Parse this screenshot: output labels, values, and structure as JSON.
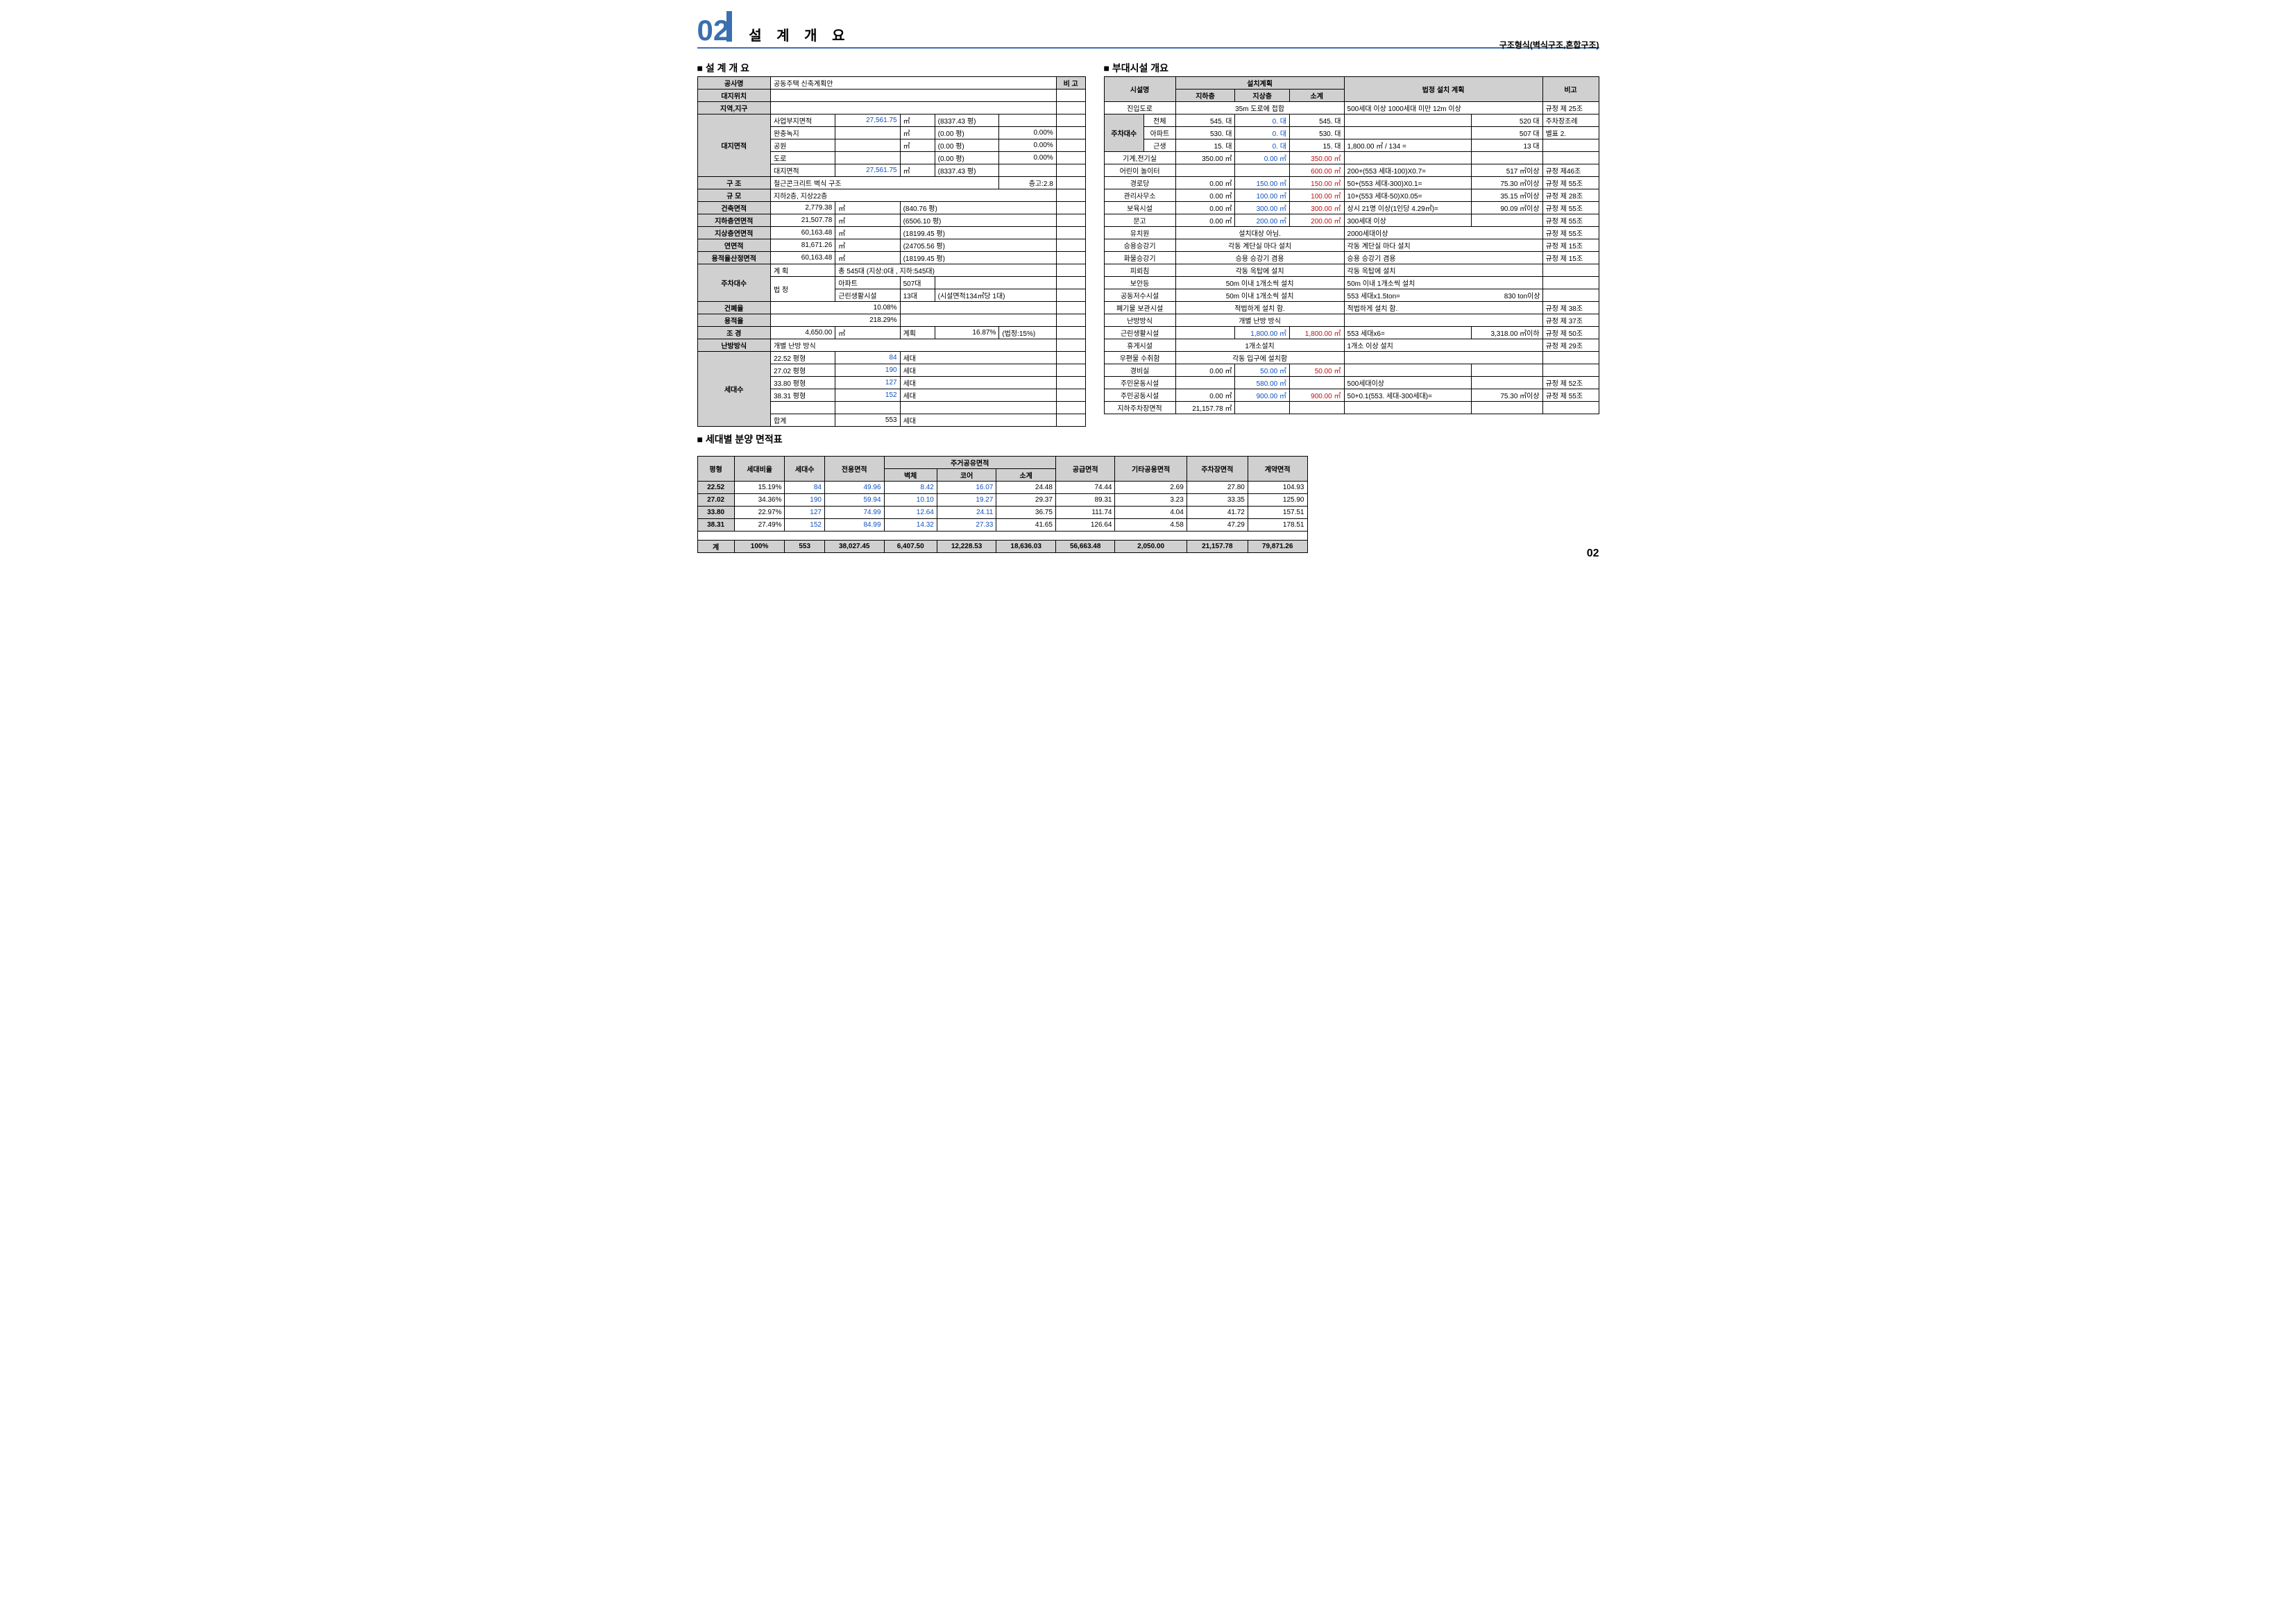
{
  "header": {
    "num": "02",
    "title": "설 계 개 요",
    "sub": "구조형식(벽식구조,혼합구조)",
    "pageNum": "02"
  },
  "sec": {
    "t1": "설 계 개 요",
    "t2": "부대시설 개요",
    "t3": "세대별 분양 면적표"
  },
  "t1": {
    "h": {
      "bigo": "비 고",
      "gongsa": "공사명",
      "gongsa_v": "공동주택 신축계획안",
      "daeji": "대지위치",
      "jiyeok": "지역,지구"
    },
    "dm": {
      "label": "대지면적",
      "r1": {
        "a": "사업부지면적",
        "b": "27,561.75",
        "c": "㎡",
        "d": "(8337.43 평)",
        "e": ""
      },
      "r2": {
        "a": "완충녹지",
        "b": "",
        "c": "㎡",
        "d": "(0.00 평)",
        "e": "0.00%"
      },
      "r3": {
        "a": "공원",
        "b": "",
        "c": "㎡",
        "d": "(0.00 평)",
        "e": "0.00%"
      },
      "r4": {
        "a": "도로",
        "b": "",
        "c": "",
        "d": "(0.00 평)",
        "e": "0.00%"
      },
      "r5": {
        "a": "대지면적",
        "b": "27,561.75",
        "c": "㎡",
        "d": "(8337.43 평)",
        "e": ""
      }
    },
    "gu": {
      "a": "구   조",
      "b": "철근콘크리트 벽식 구조",
      "c": "층고:2.8"
    },
    "gyu": {
      "a": "규   모",
      "b": "지하2층, 지상22층"
    },
    "gm": {
      "a": "건축면적",
      "b": "2,779.38",
      "c": "㎡",
      "d": "(840.76 평)"
    },
    "jh": {
      "a": "지하층연면적",
      "b": "21,507.78",
      "c": "㎡",
      "d": "(6506.10 평)"
    },
    "js": {
      "a": "지상층연면적",
      "b": "60,163.48",
      "c": "㎡",
      "d": "(18199.45 평)"
    },
    "ym": {
      "a": "연면적",
      "b": "81,671.26",
      "c": "㎡",
      "d": "(24705.56 평)"
    },
    "yr": {
      "a": "용적율산정면적",
      "b": "60,163.48",
      "c": "㎡",
      "d": "(18199.45 평)"
    },
    "ju": {
      "label": "주차대수",
      "r1": {
        "a": "계 획",
        "b": "총  545대 (지상:0대 , 지하:545대)"
      },
      "r2": {
        "a": "법  정",
        "b": "아파트",
        "c": "507대"
      },
      "r3": {
        "b": "근린생활시설",
        "c": "13대",
        "d": "(시설면적134㎡당 1대)"
      }
    },
    "gp": {
      "a": "건폐율",
      "b": "10.08%"
    },
    "yj": {
      "a": "용적율",
      "b": "218.29%"
    },
    "jo": {
      "a": "조   경",
      "b": "4,650.00",
      "c": "㎡",
      "d": "계획",
      "e": "16.87%",
      "f": "(법정:15%)"
    },
    "nb": {
      "a": "난방방식",
      "b": "개별 난방 방식"
    },
    "sd": {
      "label": "세대수",
      "r1": {
        "a": "22.52 평형",
        "b": "84",
        "c": "세대"
      },
      "r2": {
        "a": "27.02 평형",
        "b": "190",
        "c": "세대"
      },
      "r3": {
        "a": "33.80 평형",
        "b": "127",
        "c": "세대"
      },
      "r4": {
        "a": "38.31 평형",
        "b": "152",
        "c": "세대"
      },
      "r6": {
        "a": "합계",
        "b": "553",
        "c": "세대"
      }
    }
  },
  "t2": {
    "h": {
      "sisul": "시설명",
      "plan": "설치계획",
      "jh": "지하층",
      "js": "지상층",
      "so": "소계",
      "law": "법정 설치 계획",
      "bigo": "비고"
    },
    "rows": [
      {
        "a": "진입도로",
        "m": "35m 도로에 접합",
        "law": "500세대 이상 1000세대 미만 12m 이상",
        "bg": "규정 제 25조"
      },
      {
        "a": "주차대수",
        "sp": "3",
        "sub": [
          {
            "b": "전체",
            "c": "545. 대",
            "d": "0. 대",
            "e": "545. 대",
            "law": "",
            "lv": "520 대",
            "bg": "주차장조례"
          },
          {
            "b": "아파트",
            "c": "530. 대",
            "d": "0. 대",
            "e": "530. 대",
            "law": "",
            "lv": "507 대",
            "bg": "별표 2."
          },
          {
            "b": "근생",
            "c": "15. 대",
            "d": "0. 대",
            "e": "15. 대",
            "law": "1,800.00 ㎡ / 134   =",
            "lv": "13 대",
            "bg": ""
          }
        ]
      },
      {
        "a": "기계,전기실",
        "c": "350.00 ㎡",
        "d": "0.00 ㎡",
        "e": "350.00 ㎡",
        "law": "",
        "bg": ""
      },
      {
        "a": "어린이 놀이터",
        "c": "",
        "d": "",
        "e": "600.00 ㎡",
        "law": "200+(553 세대-100)X0.7=",
        "lv": "517 ㎡이상",
        "bg": "규정 제46조"
      },
      {
        "a": "경로당",
        "c": "0.00 ㎡",
        "d": "150.00 ㎡",
        "e": "150.00 ㎡",
        "law": "50+(553 세대-300)X0.1=",
        "lv": "75.30 ㎡이상",
        "bg": "규정 제 55조"
      },
      {
        "a": "관리사무소",
        "c": "0.00 ㎡",
        "d": "100.00 ㎡",
        "e": "100.00 ㎡",
        "law": "10+(553 세대-50)X0.05=",
        "lv": "35.15 ㎡이상",
        "bg": "규정 제 28조"
      },
      {
        "a": "보육시설",
        "c": "0.00 ㎡",
        "d": "300.00 ㎡",
        "e": "300.00 ㎡",
        "law": "상시 21명 이상(1인당 4.29㎡)=",
        "lv": "90.09 ㎡이상",
        "bg": "규정 제 55조"
      },
      {
        "a": "문고",
        "c": "0.00 ㎡",
        "d": "200.00 ㎡",
        "e": "200.00 ㎡",
        "law": "300세대 이상",
        "lv": "",
        "bg": "규정 제 55조"
      },
      {
        "a": "유치원",
        "m": "설치대상 아님.",
        "law": "2000세대이상",
        "bg": "규정 제 55조"
      },
      {
        "a": "승용승강기",
        "m": "각동 계단실 마다 설치",
        "law": "각동 계단실 마다 설치",
        "bg": "규정 제 15조"
      },
      {
        "a": "화물승강기",
        "m": "승용 승강기 겸용",
        "law": "승용 승강기 겸용",
        "bg": "규정 제 15조"
      },
      {
        "a": "피뢰침",
        "m": "각동 옥탑에 설치",
        "law": "각동 옥탑에 설치",
        "bg": ""
      },
      {
        "a": "보안등",
        "m": "50m 이내 1개소씩 설치",
        "law": "50m 이내 1개소씩 설치",
        "bg": ""
      },
      {
        "a": "공동저수시설",
        "m": "50m 이내 1개소씩 설치",
        "law": "553 세대x1.5ton=",
        "lv": "830 ton이상",
        "bg": ""
      },
      {
        "a": "폐기물 보관시설",
        "m": "적법하게 설치 함.",
        "law": "적법하게 설치 함.",
        "bg": "규정 제 38조"
      },
      {
        "a": "난방방식",
        "m": "개별 난방 방식",
        "law": "",
        "bg": "규정 제 37조"
      },
      {
        "a": "근린생활시설",
        "c": "",
        "d": "1,800.00 ㎡",
        "e": "1,800.00 ㎡",
        "law": "553 세대x6=",
        "lv": "3,318.00 ㎡이하",
        "bg": "규정 제 50조"
      },
      {
        "a": "휴게시설",
        "m": "1개소설치",
        "law": "1개소 이상 설치",
        "bg": "규정 제 29조"
      },
      {
        "a": "우편물 수취함",
        "m": "각동 입구에 설치함",
        "law": "",
        "bg": ""
      },
      {
        "a": "경비실",
        "c": "0.00 ㎡",
        "d": "50.00 ㎡",
        "e": "50.00 ㎡",
        "law": "",
        "bg": ""
      },
      {
        "a": "주민운동시설",
        "c": "",
        "d": "580.00 ㎡",
        "e": "",
        "law": "500세대이상",
        "bg": "규정 제 52조"
      },
      {
        "a": "주민공동시설",
        "c": "0.00 ㎡",
        "d": "900.00 ㎡",
        "e": "900.00 ㎡",
        "law": "50+0.1(553. 세대-300세대)=",
        "lv": "75.30 ㎡이상",
        "bg": "규정 제 55조"
      },
      {
        "a": "지하주차장면적",
        "c": "21,157.78 ㎡",
        "d": "",
        "e": "",
        "law": "",
        "bg": ""
      }
    ]
  },
  "t3": {
    "h": {
      "a": "평형",
      "b": "세대비율",
      "c": "세대수",
      "d": "전용면적",
      "e": "주거공유면적",
      "e1": "벽체",
      "e2": "코어",
      "e3": "소계",
      "f": "공급면적",
      "g": "기타공용면적",
      "h": "주차장면적",
      "i": "계약면적"
    },
    "rows": [
      {
        "a": "22.52",
        "b": "15.19%",
        "c": "84",
        "d": "49.96",
        "e1": "8.42",
        "e2": "16.07",
        "e3": "24.48",
        "f": "74.44",
        "g": "2.69",
        "h": "27.80",
        "i": "104.93"
      },
      {
        "a": "27.02",
        "b": "34.36%",
        "c": "190",
        "d": "59.94",
        "e1": "10.10",
        "e2": "19.27",
        "e3": "29.37",
        "f": "89.31",
        "g": "3.23",
        "h": "33.35",
        "i": "125.90"
      },
      {
        "a": "33.80",
        "b": "22.97%",
        "c": "127",
        "d": "74.99",
        "e1": "12.64",
        "e2": "24.11",
        "e3": "36.75",
        "f": "111.74",
        "g": "4.04",
        "h": "41.72",
        "i": "157.51"
      },
      {
        "a": "38.31",
        "b": "27.49%",
        "c": "152",
        "d": "84.99",
        "e1": "14.32",
        "e2": "27.33",
        "e3": "41.65",
        "f": "126.64",
        "g": "4.58",
        "h": "47.29",
        "i": "178.51"
      }
    ],
    "tot": {
      "a": "계",
      "b": "100%",
      "c": "553",
      "d": "38,027.45",
      "e1": "6,407.50",
      "e2": "12,228.53",
      "e3": "18,636.03",
      "f": "56,663.48",
      "g": "2,050.00",
      "h": "21,157.78",
      "i": "79,871.26"
    }
  }
}
